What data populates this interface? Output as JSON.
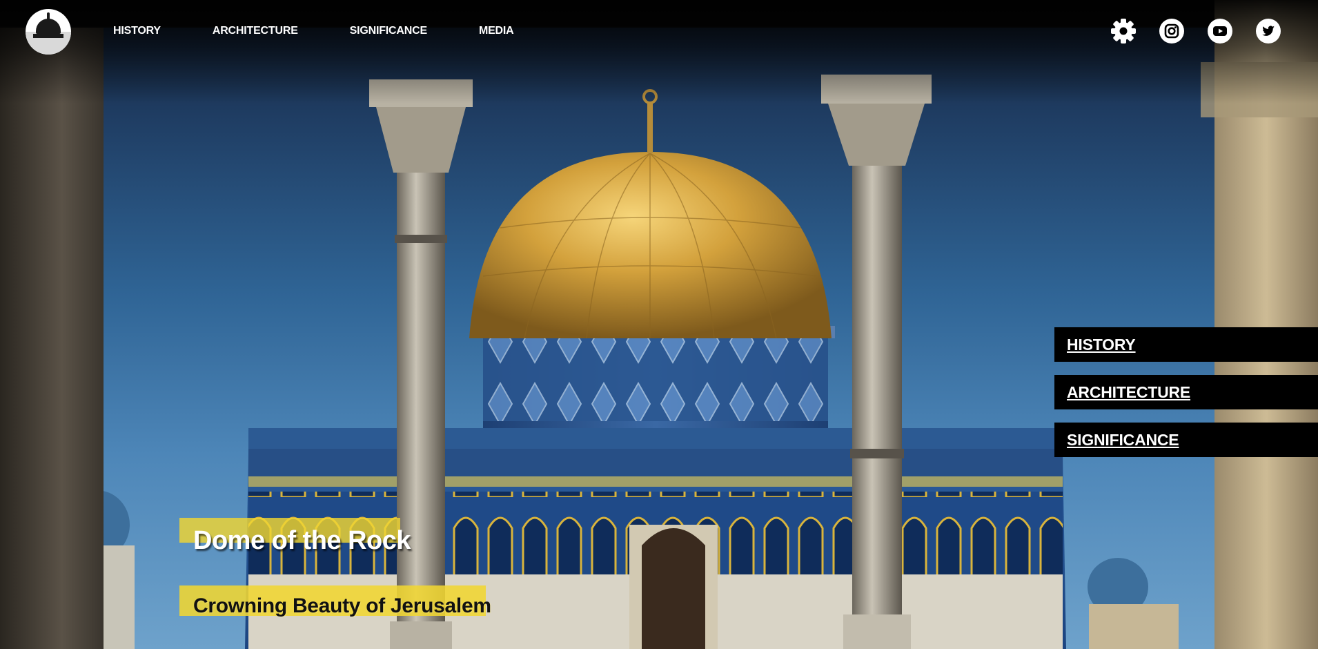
{
  "header": {
    "nav": [
      "HISTORY",
      "ARCHITECTURE",
      "SIGNIFICANCE",
      "MEDIA"
    ],
    "social_icons": [
      "settings-icon",
      "instagram-icon",
      "youtube-icon",
      "twitter-icon"
    ]
  },
  "side_menu": {
    "items": [
      "HISTORY",
      "ARCHITECTURE",
      "SIGNIFICANCE"
    ]
  },
  "hero": {
    "title": "Dome of the Rock",
    "subtitle": "Crowning Beauty of Jerusalem"
  },
  "colors": {
    "accent_yellow": "#f0d632",
    "menu_background": "#000000",
    "text_light": "#ffffff"
  }
}
